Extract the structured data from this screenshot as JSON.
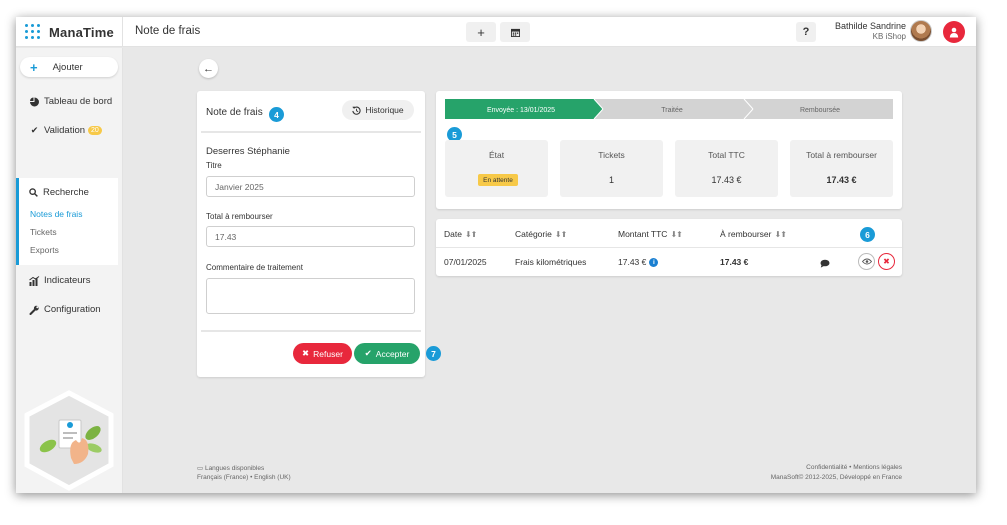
{
  "app": {
    "name": "ManaTime",
    "page_title": "Note de frais"
  },
  "topbar": {
    "add_icon": "plus-icon",
    "calendar_icon": "calendar-icon",
    "help_label": "?",
    "user_name": "Bathilde Sandrine",
    "user_company": "KB iShop"
  },
  "sidebar": {
    "add_label": "Ajouter",
    "dashboard_label": "Tableau de bord",
    "validation_label": "Validation",
    "validation_badge": "20",
    "search_label": "Recherche",
    "search_items": [
      "Notes de frais",
      "Tickets",
      "Exports"
    ],
    "indicators_label": "Indicateurs",
    "config_label": "Configuration"
  },
  "form": {
    "title": "Note de frais",
    "step": "4",
    "history_label": "Historique",
    "person": "Deserres Stéphanie",
    "title_label": "Titre",
    "title_value": "Janvier 2025",
    "total_label": "Total à rembourser",
    "total_value": "17.43",
    "comment_label": "Commentaire de traitement",
    "comment_value": "",
    "refuse_label": "Refuser",
    "accept_label": "Accepter",
    "accept_step": "7"
  },
  "status": {
    "step": "5",
    "progress": [
      "Envoyée : 13/01/2025",
      "Traitée",
      "Remboursée"
    ],
    "progress_active_color": "#26a36a",
    "state_header": "État",
    "state_value": "En attente",
    "tickets_header": "Tickets",
    "tickets_value": "1",
    "ttc_header": "Total TTC",
    "ttc_value": "17.43 €",
    "reimb_header": "Total à rembourser",
    "reimb_value": "17.43 €"
  },
  "table": {
    "step": "6",
    "columns": [
      "Date",
      "Catégorie",
      "Montant TTC",
      "À rembourser"
    ],
    "rows": [
      {
        "date": "07/01/2025",
        "category": "Frais kilométriques",
        "amount": "17.43 €",
        "reimburse": "17.43 €"
      }
    ]
  },
  "footer": {
    "languages_title": "Langues disponibles",
    "languages": "Français (France) • English (UK)",
    "legal": "Confidentialité • Mentions légales",
    "copyright": "ManaSoft© 2012-2025, Développé en France"
  },
  "colors": {
    "accent": "#1a9bd7",
    "danger": "#e8283c",
    "success": "#26a36a",
    "warning": "#f7c948"
  }
}
